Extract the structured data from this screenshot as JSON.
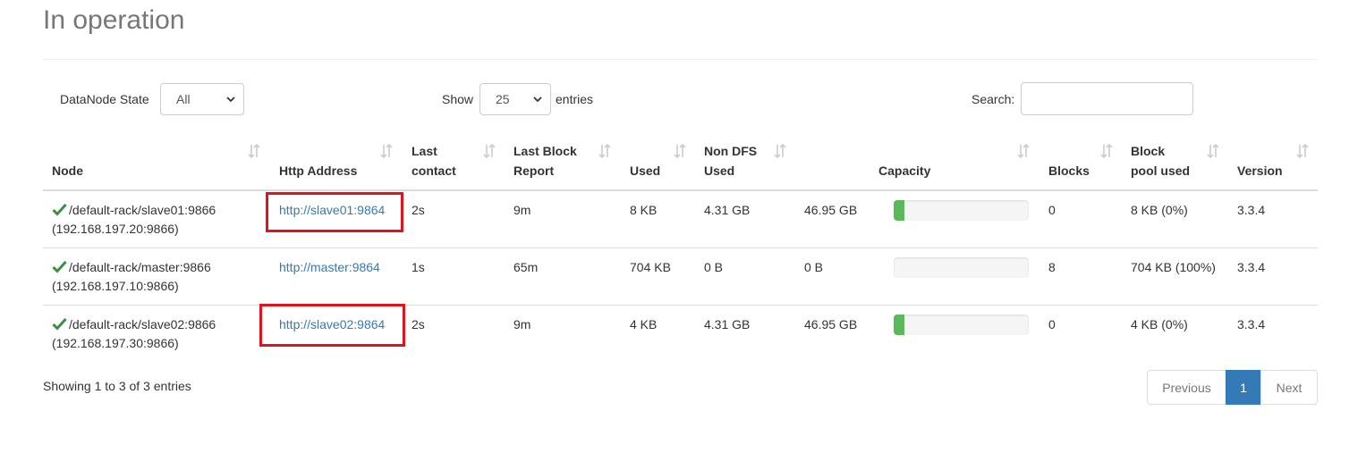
{
  "page": {
    "title": "In operation"
  },
  "filters": {
    "state_label": "DataNode State",
    "state_value": "All",
    "show_label": "Show",
    "show_value": "25",
    "entries_label": "entries",
    "search_label": "Search:",
    "search_value": ""
  },
  "table": {
    "columns": [
      {
        "line1": "",
        "line2": "Node"
      },
      {
        "line1": "",
        "line2": "Http Address"
      },
      {
        "line1": "Last",
        "line2": "contact"
      },
      {
        "line1": "Last Block",
        "line2": "Report"
      },
      {
        "line1": "",
        "line2": "Used"
      },
      {
        "line1": "Non DFS",
        "line2": "Used"
      },
      {
        "line1": "",
        "line2": "Capacity"
      },
      {
        "line1": "",
        "line2": "Blocks"
      },
      {
        "line1": "Block",
        "line2": "pool used"
      },
      {
        "line1": "",
        "line2": "Version"
      }
    ],
    "rows": [
      {
        "node": "/default-rack/slave01:9866",
        "node_ip": "(192.168.197.20:9866)",
        "http": "http://slave01:9864",
        "last_contact": "2s",
        "last_block_report": "9m",
        "used": "8 KB",
        "non_dfs_used": "4.31 GB",
        "capacity": "46.95 GB",
        "capacity_used_fraction": 0.08,
        "blocks": "0",
        "block_pool_used": "8 KB (0%)",
        "version": "3.3.4",
        "highlighted": true
      },
      {
        "node": "/default-rack/master:9866",
        "node_ip": "(192.168.197.10:9866)",
        "http": "http://master:9864",
        "last_contact": "1s",
        "last_block_report": "65m",
        "used": "704 KB",
        "non_dfs_used": "0 B",
        "capacity": "0 B",
        "capacity_used_fraction": 0.0,
        "blocks": "8",
        "block_pool_used": "704 KB (100%)",
        "version": "3.3.4",
        "highlighted": false
      },
      {
        "node": "/default-rack/slave02:9866",
        "node_ip": "(192.168.197.30:9866)",
        "http": "http://slave02:9864",
        "last_contact": "2s",
        "last_block_report": "9m",
        "used": "4 KB",
        "non_dfs_used": "4.31 GB",
        "capacity": "46.95 GB",
        "capacity_used_fraction": 0.08,
        "blocks": "0",
        "block_pool_used": "4 KB (0%)",
        "version": "3.3.4",
        "highlighted": true
      }
    ]
  },
  "footer": {
    "info": "Showing 1 to 3 of 3 entries",
    "previous": "Previous",
    "current_page": "1",
    "next": "Next"
  },
  "colors": {
    "accent": "#337ab7",
    "success": "#5cb85c",
    "highlight": "#e0121c"
  },
  "icons": [
    "check-icon",
    "sort-icon",
    "chevron-down-icon"
  ]
}
